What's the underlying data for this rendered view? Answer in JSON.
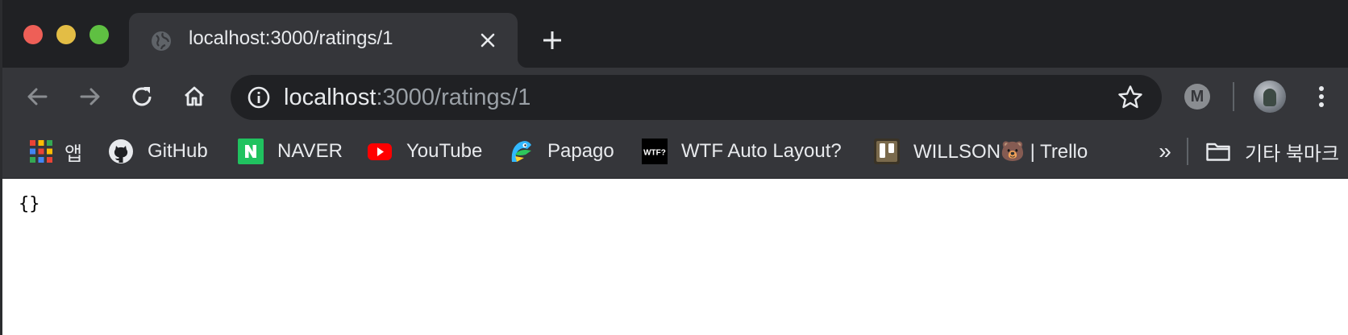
{
  "browser": {
    "theme": {
      "frame": "#202124",
      "toolbar": "#35363a",
      "text": "#e8eaed",
      "muted": "#9aa0a6"
    },
    "window_controls": [
      "close",
      "minimize",
      "zoom"
    ],
    "tab": {
      "title": "localhost:3000/ratings/1",
      "favicon": "globe-icon"
    },
    "address_bar": {
      "host": "localhost",
      "path": ":3000/ratings/1",
      "info_icon": "info-icon"
    },
    "toolbar_icons": [
      "back-icon",
      "forward-icon",
      "reload-icon",
      "home-icon",
      "bookmark-star-icon",
      "extension-m-icon",
      "profile-avatar",
      "menu-icon"
    ],
    "extension": {
      "letter": "M"
    }
  },
  "bookmarks": {
    "items": [
      {
        "label": "앱",
        "icon": "apps-grid-icon"
      },
      {
        "label": "GitHub",
        "icon": "github-icon"
      },
      {
        "label": "NAVER",
        "icon": "naver-icon"
      },
      {
        "label": "YouTube",
        "icon": "youtube-icon"
      },
      {
        "label": "Papago",
        "icon": "papago-icon"
      },
      {
        "label": "WTF Auto Layout?",
        "icon": "wtf-icon"
      },
      {
        "label": "WILLSON🐻 | Trello",
        "icon": "trello-icon"
      }
    ],
    "overflow_label": "»",
    "other_bookmarks": {
      "label": "기타 북마크",
      "icon": "folder-icon"
    }
  },
  "page": {
    "body_text": "{}"
  }
}
